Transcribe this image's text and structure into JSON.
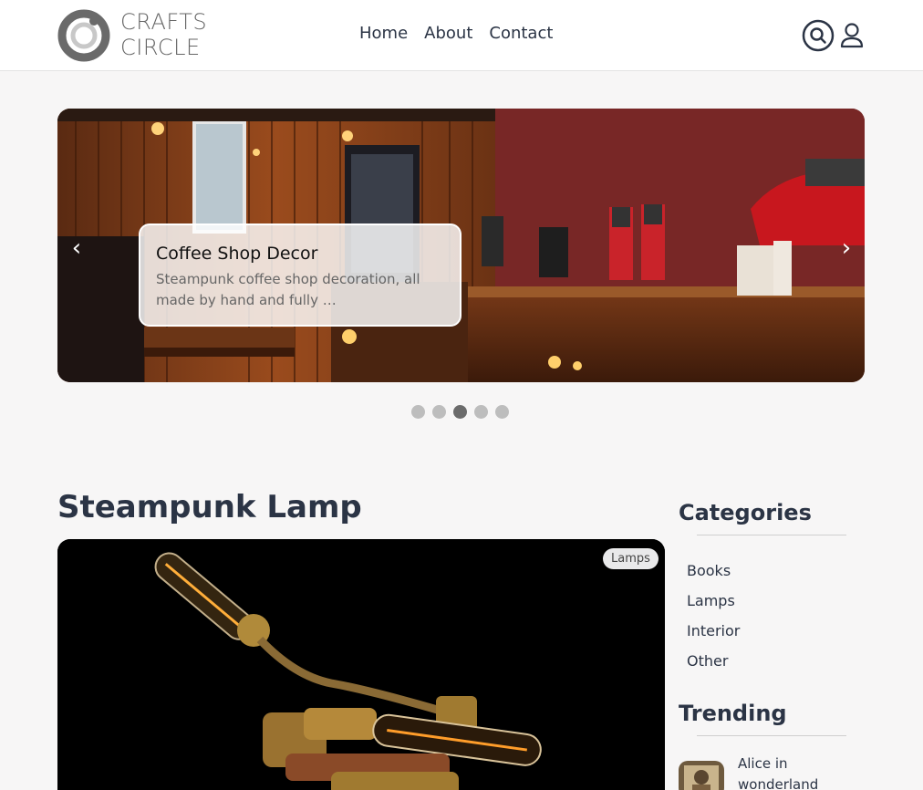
{
  "brand": {
    "line1": "CRAFTS",
    "line2": "CIRCLE",
    "logo_icon": "crafts-circle-logo"
  },
  "nav": {
    "items": [
      {
        "label": "Home"
      },
      {
        "label": "About"
      },
      {
        "label": "Contact"
      }
    ]
  },
  "header_actions": {
    "search_icon": "search-icon",
    "user_icon": "user-icon"
  },
  "carousel": {
    "slide": {
      "title": "Coffee Shop Decor",
      "description": "Steampunk coffee shop decoration, all made by hand and fully …"
    },
    "prev_label": "‹",
    "next_label": "›",
    "slide_count": 5,
    "active_index": 2
  },
  "article": {
    "title": "Steampunk Lamp",
    "tag": "Lamps"
  },
  "sidebar": {
    "categories_heading": "Categories",
    "categories": [
      {
        "label": "Books"
      },
      {
        "label": "Lamps"
      },
      {
        "label": "Interior"
      },
      {
        "label": "Other"
      }
    ],
    "trending_heading": "Trending",
    "trending": [
      {
        "title": "Alice in wonderland"
      }
    ]
  },
  "colors": {
    "background": "#f7f6f6",
    "text_primary": "#2b3445",
    "dot_active": "#6b6b6b",
    "dot_inactive": "#bdbdbd"
  }
}
